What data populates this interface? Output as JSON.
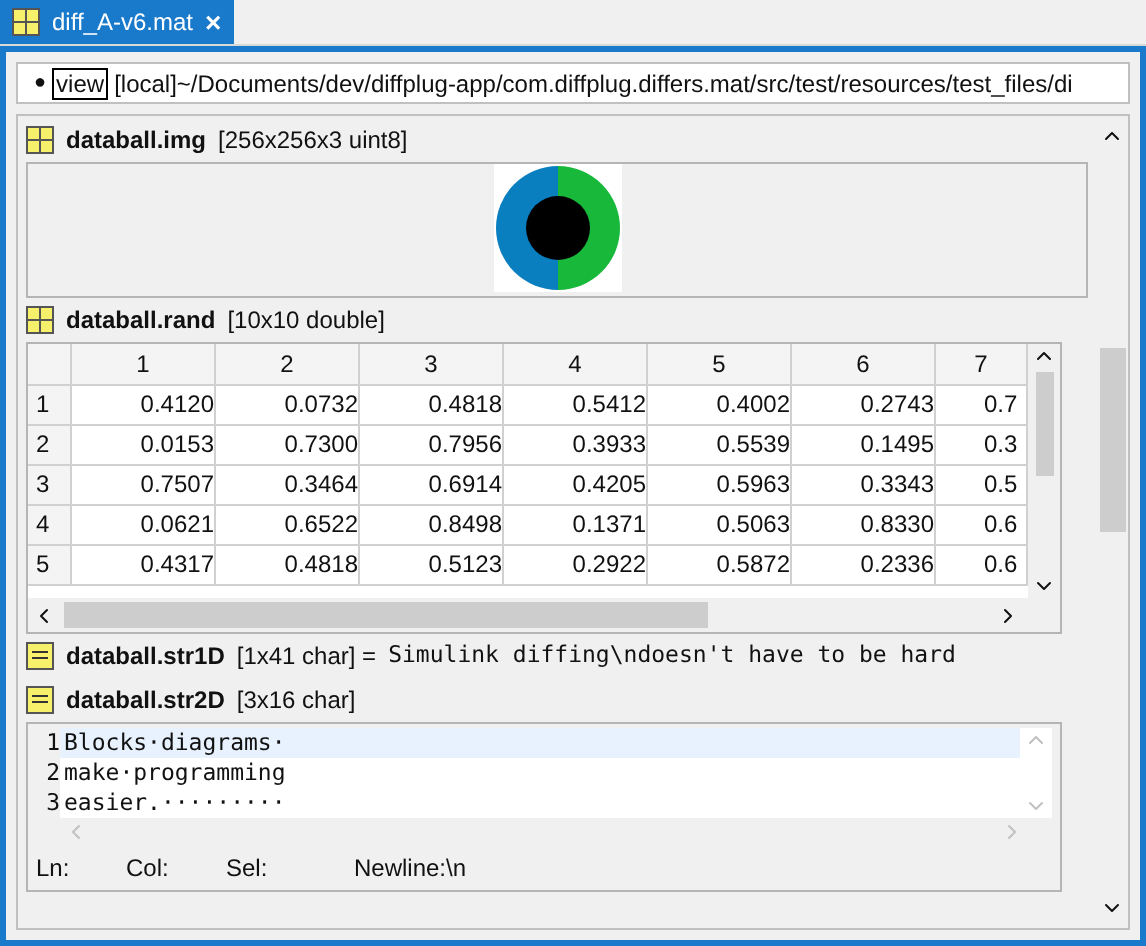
{
  "tab": {
    "title": "diff_A-v6.mat",
    "selected": true,
    "close": "×"
  },
  "path_bar": {
    "marker": "●",
    "mode": "view",
    "path": "[local]~/Documents/dev/diffplug-app/com.diffplug.differs.mat/src/test/resources/test_files/di"
  },
  "sections": [
    {
      "kind": "image",
      "name": "databall.img",
      "info": "[256x256x3 uint8]"
    },
    {
      "kind": "table",
      "name": "databall.rand",
      "info": "[10x10 double]",
      "table": {
        "columns": [
          "1",
          "2",
          "3",
          "4",
          "5",
          "6",
          "7"
        ],
        "rows": [
          {
            "label": "1",
            "cells": [
              "0.4120",
              "0.0732",
              "0.4818",
              "0.5412",
              "0.4002",
              "0.2743",
              "0.7"
            ]
          },
          {
            "label": "2",
            "cells": [
              "0.0153",
              "0.7300",
              "0.7956",
              "0.3933",
              "0.5539",
              "0.1495",
              "0.3"
            ]
          },
          {
            "label": "3",
            "cells": [
              "0.7507",
              "0.3464",
              "0.6914",
              "0.4205",
              "0.5963",
              "0.3343",
              "0.5"
            ]
          },
          {
            "label": "4",
            "cells": [
              "0.0621",
              "0.6522",
              "0.8498",
              "0.1371",
              "0.5063",
              "0.8330",
              "0.6"
            ]
          },
          {
            "label": "5",
            "cells": [
              "0.4317",
              "0.4818",
              "0.5123",
              "0.2922",
              "0.5872",
              "0.2336",
              "0.6"
            ]
          }
        ]
      }
    },
    {
      "kind": "string",
      "name": "databall.str1D",
      "info": "[1x41 char] =",
      "value": "Simulink diffing\\ndoesn't have to be hard"
    },
    {
      "kind": "text",
      "name": "databall.str2D",
      "info": "[3x16 char]",
      "lines": [
        {
          "number": "1",
          "text": "Blocks·diagrams·",
          "selected": true
        },
        {
          "number": "2",
          "text": "make·programming",
          "selected": false
        },
        {
          "number": "3",
          "text": "easier.·········",
          "selected": false
        }
      ],
      "status": [
        "Ln:",
        "Col:",
        "Sel:",
        "Newline:\\n"
      ]
    }
  ]
}
